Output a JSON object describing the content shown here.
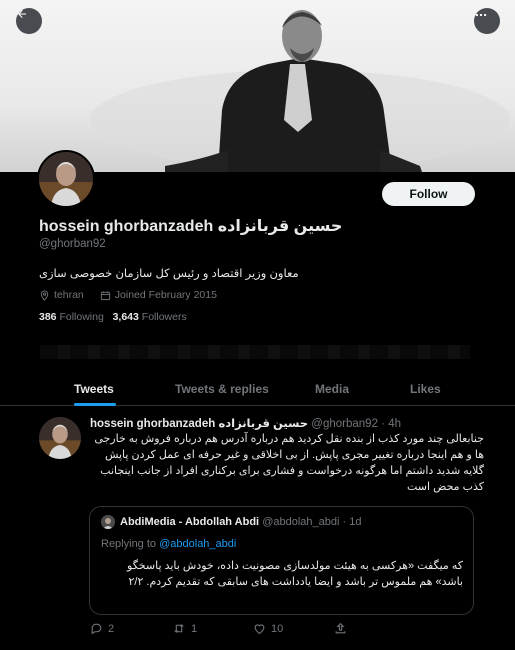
{
  "profile": {
    "name": "hossein ghorbanzadeh حسین قربانزاده",
    "handle": "@ghorban92",
    "bio": "معاون وزیر اقتصاد و رئیس کل سازمان خصوصی سازی",
    "location": "tehran",
    "joined": "Joined February 2015",
    "following_count": "386",
    "following_label": "Following",
    "followers_count": "3,643",
    "followers_label": "Followers",
    "follow_button": "Follow"
  },
  "tabs": [
    {
      "label": "Tweets",
      "active": true
    },
    {
      "label": "Tweets & replies",
      "active": false
    },
    {
      "label": "Media",
      "active": false
    },
    {
      "label": "Likes",
      "active": false
    }
  ],
  "tweet": {
    "author_name": "hossein ghorbanzadeh حسین قربانزاده",
    "author_handle": "@ghorban92",
    "time": "· 4h",
    "text": "جنابعالی چند مورد کذب از بنده نقل کردید هم درباره آدرس هم درباره فروش به خارجی ها و هم اینجا درباره تغییر مجری پاپش. از بی اخلاقی و غیر حرفه ای عمل کردن پاپش گلایه شدید داشتم اما هرگونه درخواست و فشاری برای برکناری افراد از جانب اینجانب کذب محض است",
    "quote": {
      "author_name": "AbdiMedia - Abdollah Abdi",
      "author_handle": "@abdolah_abdi",
      "time": "· 1d",
      "replying_label": "Replying to",
      "replying_to": "@abdolah_abdi",
      "text": "که میگفت «هرکسی به هیئت مولدسازی مصونیت داده، خودش باید پاسخگو باشد» هم ملموس تر باشد و ایضا یادداشت های سابقی که تقدیم کردم. ۲/۲"
    },
    "actions": {
      "replies": "2",
      "retweets": "1",
      "likes": "10"
    }
  },
  "colors": {
    "accent": "#1d9bf0",
    "background": "#000000",
    "text": "#e7e9ea",
    "muted": "#71767b",
    "border": "#2f3336"
  },
  "icons": {
    "back": "arrow-left-icon",
    "more": "more-horizontal-icon",
    "location": "location-pin-icon",
    "calendar": "calendar-icon",
    "reply": "reply-icon",
    "retweet": "retweet-icon",
    "like": "heart-icon",
    "share": "share-icon"
  }
}
